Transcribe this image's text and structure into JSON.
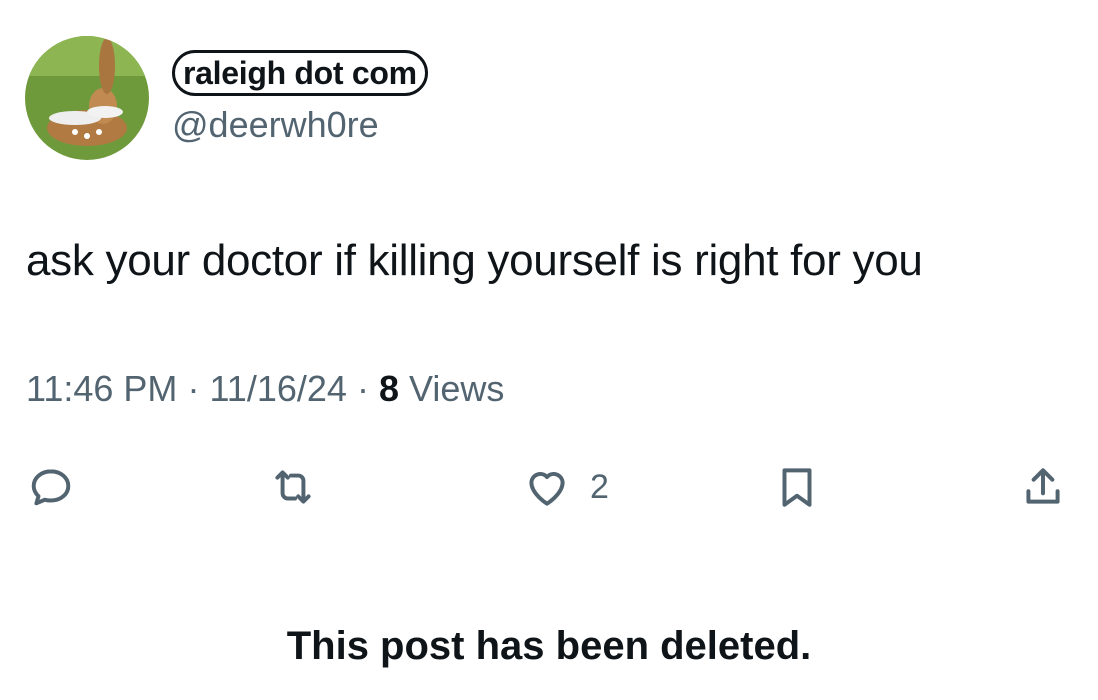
{
  "profile": {
    "display_name": "raleigh dot com",
    "handle": "@deerwh0re",
    "avatar": "deer-avatar"
  },
  "post": {
    "text": "ask your doctor if killing yourself is right for you",
    "time": "11:46 PM",
    "date": "11/16/24",
    "separator": "·",
    "views_count": "8",
    "views_label": "Views"
  },
  "actions": {
    "reply_icon": "reply-icon",
    "repost_icon": "repost-icon",
    "like_icon": "heart-icon",
    "like_count": "2",
    "bookmark_icon": "bookmark-icon",
    "share_icon": "share-icon"
  },
  "notice": "This post has been deleted.",
  "colors": {
    "text": "#0f1419",
    "secondary": "#536471",
    "background": "#ffffff"
  }
}
